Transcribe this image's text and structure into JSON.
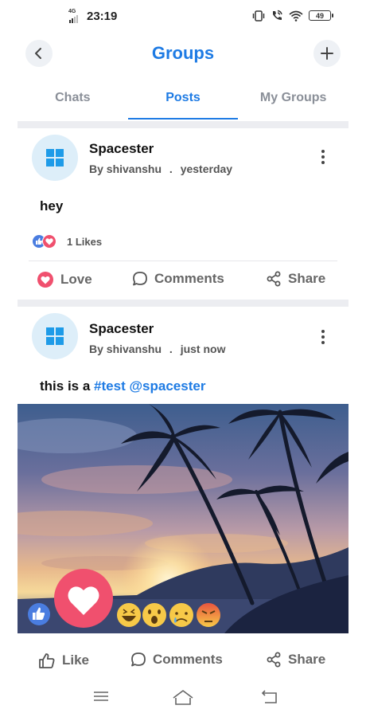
{
  "status_bar": {
    "network": "4G",
    "time": "23:19",
    "battery": "49"
  },
  "header": {
    "title": "Groups",
    "back_icon": "chevron-left-icon",
    "add_icon": "plus-icon"
  },
  "tabs": [
    {
      "label": "Chats",
      "active": false
    },
    {
      "label": "Posts",
      "active": true
    },
    {
      "label": "My Groups",
      "active": false
    }
  ],
  "posts": [
    {
      "author": "Spacester",
      "by_label": "By shivanshu",
      "dot": ".",
      "time": "yesterday",
      "text": "hey",
      "likes": "1 Likes",
      "actions": {
        "like": "Love",
        "comments": "Comments",
        "share": "Share"
      }
    },
    {
      "author": "Spacester",
      "by_label": "By shivanshu",
      "dot": ".",
      "time": "just now",
      "text_prefix": "this is a",
      "hashtag": "#test",
      "mention": "@spacester",
      "actions": {
        "like": "Like",
        "comments": "Comments",
        "share": "Share"
      }
    }
  ],
  "reactions": [
    "like",
    "love",
    "haha",
    "wow",
    "sad",
    "angry"
  ],
  "colors": {
    "accent": "#1e7be4",
    "love": "#f0506e",
    "like": "#4a7de0"
  }
}
